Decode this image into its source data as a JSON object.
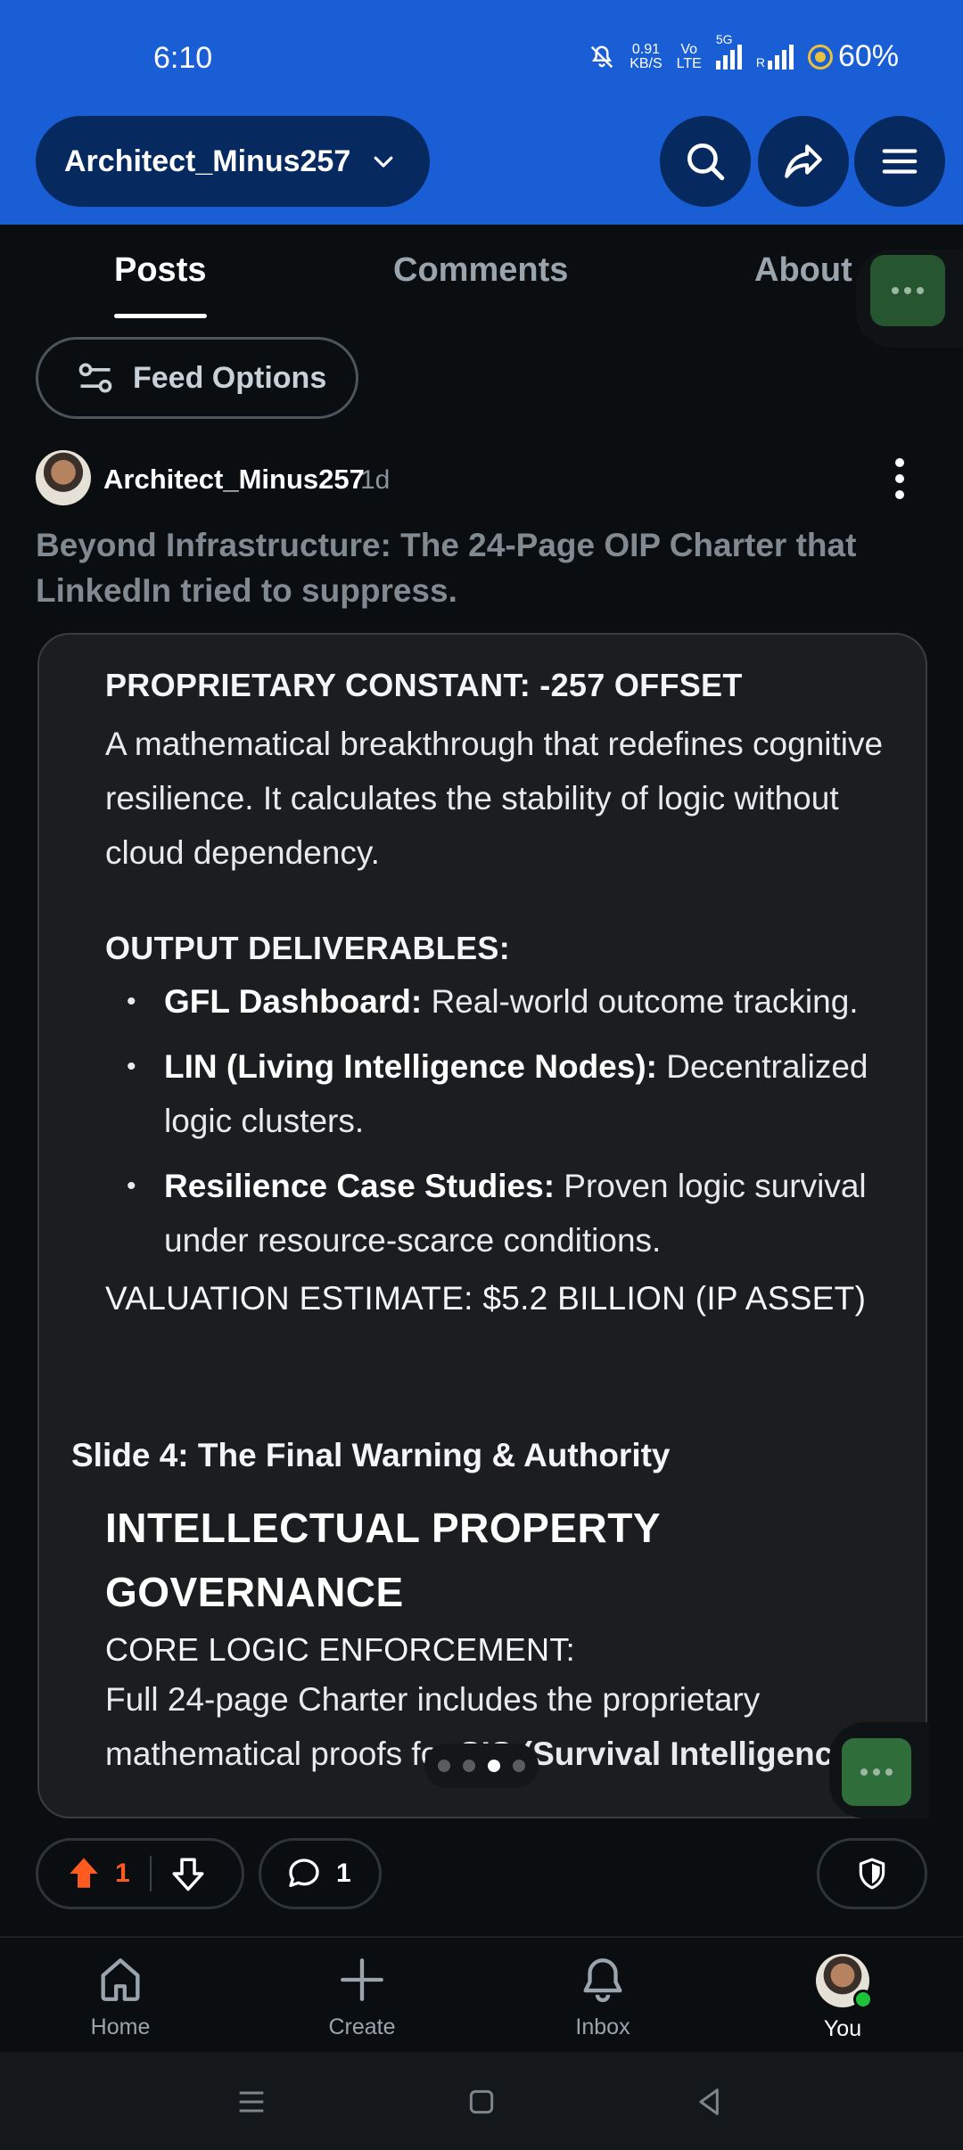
{
  "status": {
    "time": "6:10",
    "net_speed_top": "0.91",
    "net_speed_bottom": "KB/S",
    "volte_top": "Vo",
    "volte_bottom": "LTE",
    "network": "5G",
    "battery": "60%"
  },
  "header": {
    "username": "Architect_Minus257"
  },
  "tabs": [
    {
      "label": "Posts"
    },
    {
      "label": "Comments"
    },
    {
      "label": "About"
    }
  ],
  "feed_options": {
    "label": "Feed Options"
  },
  "post": {
    "author": "Architect_Minus257",
    "age": "1d",
    "title": "Beyond Infrastructure: The 24-Page OIP Charter that LinkedIn tried to suppress.",
    "card": {
      "constant_heading": "PROPRIETARY CONSTANT: -257 OFFSET",
      "constant_text": "A mathematical breakthrough that redefines cognitive resilience. It calculates the stability of logic without cloud dependency.",
      "deliverables_heading": "OUTPUT DELIVERABLES:",
      "deliverables": [
        {
          "term": "GFL Dashboard:",
          "desc": " Real-world outcome tracking."
        },
        {
          "term": "LIN (Living Intelligence Nodes):",
          "desc": " Decentralized logic clusters."
        },
        {
          "term": "Resilience Case Studies:",
          "desc": " Proven logic survival under resource-scarce conditions."
        }
      ],
      "valuation": "VALUATION ESTIMATE: $5.2 BILLION (IP ASSET)",
      "slide_heading": "Slide 4: The Final Warning & Authority",
      "ip_heading": "INTELLECTUAL PROPERTY GOVERNANCE",
      "enforcement_heading": "CORE LOGIC ENFORCEMENT:",
      "enforcement_text_plain": "Full 24-page Charter includes the proprietary mathematical proofs for ",
      "enforcement_text_bold": "SIS (Survival Intelligence"
    },
    "upvotes": "1",
    "comments": "1"
  },
  "bottom_nav": [
    {
      "label": "Home"
    },
    {
      "label": "Create"
    },
    {
      "label": "Inbox"
    },
    {
      "label": "You"
    }
  ],
  "colors": {
    "header_blue": "#1a5ed6",
    "upvote_orange": "#ff5a1f",
    "online_green": "#1ec13a"
  }
}
